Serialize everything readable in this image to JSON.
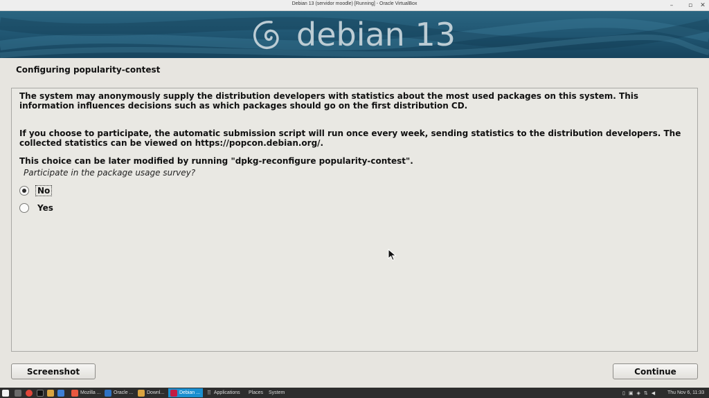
{
  "window": {
    "title": "Debian 13 (servidor moodle) [Running] - Oracle VirtualBox",
    "minimize_glyph": "–",
    "restore_glyph": "▫",
    "close_glyph": "✕"
  },
  "banner": {
    "logo_text": "debian 13",
    "logo_icon": "debian-swirl-icon"
  },
  "installer": {
    "step_title": "Configuring popularity-contest",
    "paragraphs": [
      "The system may anonymously supply the distribution developers with statistics about the most used packages on this system. This information influences decisions such as which packages should go on the first distribution CD.",
      "If you choose to participate, the automatic submission script will run once every week, sending statistics to the distribution developers. The collected statistics can be viewed on https://popcon.debian.org/.",
      "This choice can be later modified by running \"dpkg-reconfigure popularity-contest\"."
    ],
    "question": "Participate in the package usage survey?",
    "options": [
      {
        "label": "No",
        "selected": true
      },
      {
        "label": "Yes",
        "selected": false
      }
    ],
    "screenshot_button": "Screenshot",
    "continue_button": "Continue"
  },
  "taskbar": {
    "tasks": [
      {
        "label": "Mozilla ...",
        "active": false
      },
      {
        "label": "Oracle ...",
        "active": false
      },
      {
        "label": "Downl...",
        "active": false
      },
      {
        "label": "Debian ...",
        "active": true
      }
    ],
    "menus": [
      "Applications",
      "Places",
      "System"
    ],
    "clock": "Thu Nov  6, 11:33"
  },
  "colors": {
    "banner": "#1f5470",
    "installer_bg": "#e7e5e0",
    "taskbar_bg": "#2d2d2d",
    "active_task": "#1a8fd0"
  }
}
